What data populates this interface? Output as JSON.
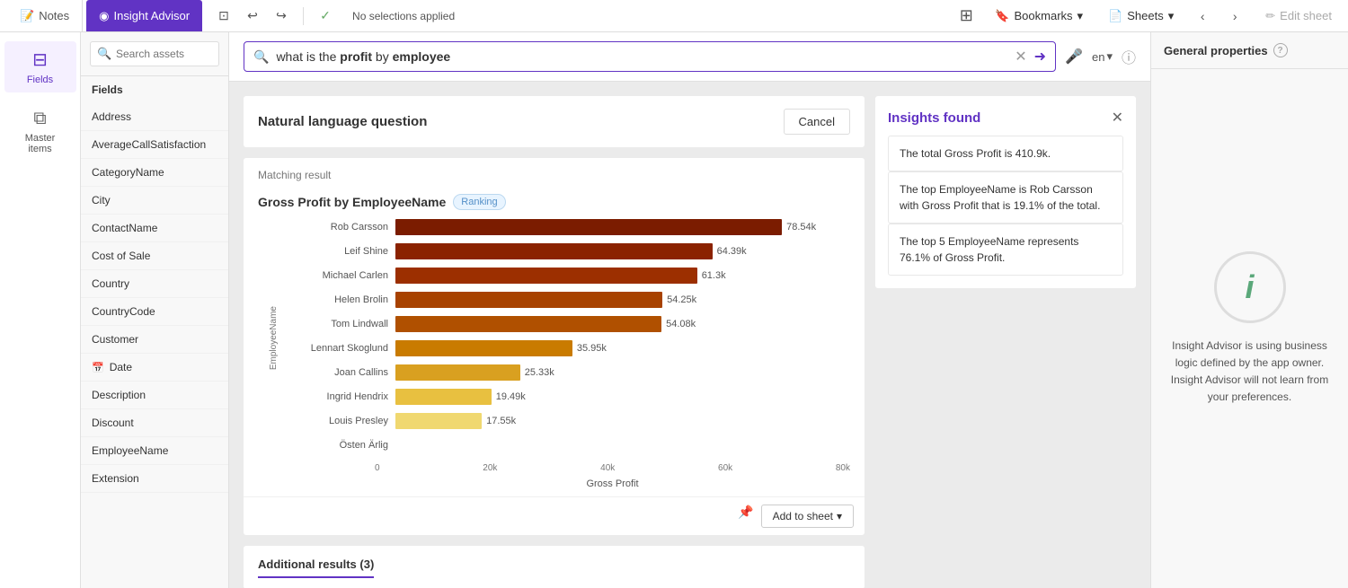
{
  "toolbar": {
    "notes_tab": "Notes",
    "insight_tab": "Insight Advisor",
    "selection_status": "No selections applied",
    "bookmarks_btn": "Bookmarks",
    "sheets_btn": "Sheets",
    "edit_btn": "Edit sheet"
  },
  "sidebar": {
    "fields_label": "Fields",
    "master_items_label": "Master items"
  },
  "fields_panel": {
    "search_placeholder": "Search assets",
    "section_title": "Fields",
    "items": [
      {
        "name": "Address",
        "type": "text"
      },
      {
        "name": "AverageCallSatisfaction",
        "type": "text"
      },
      {
        "name": "CategoryName",
        "type": "text"
      },
      {
        "name": "City",
        "type": "text"
      },
      {
        "name": "ContactName",
        "type": "text"
      },
      {
        "name": "Cost of Sale",
        "type": "text"
      },
      {
        "name": "Country",
        "type": "text"
      },
      {
        "name": "CountryCode",
        "type": "text"
      },
      {
        "name": "Customer",
        "type": "text"
      },
      {
        "name": "Date",
        "type": "calendar"
      },
      {
        "name": "Description",
        "type": "text"
      },
      {
        "name": "Discount",
        "type": "text"
      },
      {
        "name": "EmployeeName",
        "type": "text"
      },
      {
        "name": "Extension",
        "type": "text"
      }
    ]
  },
  "nlq": {
    "query_prefix": "what is the ",
    "query_bold": "profit",
    "query_middle": " by ",
    "query_suffix": "employee",
    "lang": "en",
    "header": "Natural language question",
    "cancel_btn": "Cancel"
  },
  "chart": {
    "matching_label": "Matching result",
    "title": "Gross Profit by EmployeeName",
    "badge": "Ranking",
    "y_axis_label": "EmployeeName",
    "x_axis_label": "Gross Profit",
    "x_ticks": [
      "0",
      "20k",
      "40k",
      "60k",
      "80k"
    ],
    "bars": [
      {
        "name": "Rob Carsson",
        "value": 78540,
        "display": "78.54k",
        "pct": 97
      },
      {
        "name": "Leif Shine",
        "value": 64390,
        "display": "64.39k",
        "pct": 80
      },
      {
        "name": "Michael Carlen",
        "value": 61300,
        "display": "61.3k",
        "pct": 76
      },
      {
        "name": "Helen Brolin",
        "value": 54250,
        "display": "54.25k",
        "pct": 67
      },
      {
        "name": "Tom Lindwall",
        "value": 54080,
        "display": "54.08k",
        "pct": 67
      },
      {
        "name": "Lennart Skoglund",
        "value": 35950,
        "display": "35.95k",
        "pct": 44
      },
      {
        "name": "Joan Callins",
        "value": 25330,
        "display": "25.33k",
        "pct": 31
      },
      {
        "name": "Ingrid Hendrix",
        "value": 19490,
        "display": "19.49k",
        "pct": 24
      },
      {
        "name": "Louis Presley",
        "value": 17550,
        "display": "17.55k",
        "pct": 22
      },
      {
        "name": "Östen Ärlig",
        "value": 0,
        "display": "",
        "pct": 0
      }
    ],
    "add_sheet_btn": "Add to sheet"
  },
  "bar_colors": [
    "#7b1c00",
    "#8b2200",
    "#9c2f00",
    "#a84200",
    "#b05000",
    "#c97b00",
    "#d9a020",
    "#e8c040",
    "#f0d870",
    "#f5e898"
  ],
  "insights": {
    "title": "Insights found",
    "items": [
      "The total Gross Profit is 410.9k.",
      "The top EmployeeName is Rob Carsson with Gross Profit that is 19.1% of the total.",
      "The top 5 EmployeeName represents 76.1% of Gross Profit."
    ]
  },
  "general_props": {
    "title": "General properties",
    "description": "Insight Advisor is using business logic defined by the app owner. Insight Advisor will not learn from your preferences."
  },
  "additional_results": {
    "label": "Additional results (3)"
  }
}
